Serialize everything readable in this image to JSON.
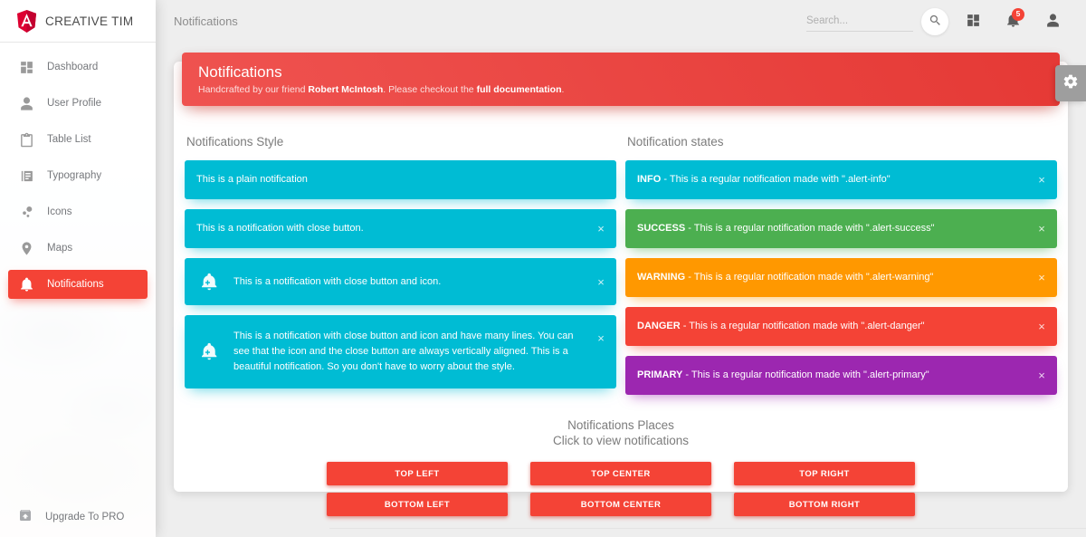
{
  "brand": {
    "name": "CREATIVE TIM",
    "logo_icon": "angular-shield-icon"
  },
  "sidebar": {
    "items": [
      {
        "label": "Dashboard",
        "icon": "dashboard-grid-icon",
        "active": false
      },
      {
        "label": "User Profile",
        "icon": "person-icon",
        "active": false
      },
      {
        "label": "Table List",
        "icon": "clipboard-icon",
        "active": false
      },
      {
        "label": "Typography",
        "icon": "library-books-icon",
        "active": false
      },
      {
        "label": "Icons",
        "icon": "bubble-chart-icon",
        "active": false
      },
      {
        "label": "Maps",
        "icon": "location-pin-icon",
        "active": false
      },
      {
        "label": "Notifications",
        "icon": "bell-icon",
        "active": true
      }
    ],
    "footer": {
      "label": "Upgrade To PRO",
      "icon": "unarchive-icon"
    }
  },
  "topbar": {
    "page_title": "Notifications",
    "search": {
      "value": "",
      "placeholder": "Search..."
    },
    "search_button_icon": "search-icon",
    "dashboard_icon": "dashboard-grid-icon",
    "notifications_icon": "bell-icon",
    "notifications_badge": "5",
    "profile_icon": "person-icon"
  },
  "gear_tab": {
    "icon": "gear-icon"
  },
  "card": {
    "header": {
      "title": "Notifications",
      "subtitle_prefix": "Handcrafted by our friend ",
      "author": "Robert McIntosh",
      "subtitle_middle": ". Please checkout the ",
      "doc_link": "full documentation",
      "subtitle_suffix": "."
    },
    "left_column": {
      "title": "Notifications Style",
      "alerts": [
        {
          "text": "This is a plain notification",
          "state": "info",
          "has_close": false,
          "has_icon": false,
          "close_label": "×"
        },
        {
          "text": "This is a notification with close button.",
          "state": "info",
          "has_close": true,
          "has_icon": false,
          "close_label": "×"
        },
        {
          "text": "This is a notification with close button and icon.",
          "state": "info",
          "has_close": true,
          "has_icon": true,
          "icon": "add-alert-icon",
          "close_label": "×"
        },
        {
          "text": "This is a notification with close button and icon and have many lines. You can see that the icon and the close button are always vertically aligned. This is a beautiful notification. So you don't have to worry about the style.",
          "state": "info",
          "has_close": true,
          "has_icon": true,
          "icon": "add-alert-icon",
          "tall": true,
          "close_label": "×"
        }
      ]
    },
    "right_column": {
      "title": "Notification states",
      "alerts": [
        {
          "label": "INFO",
          "text": " - This is a regular notification made with \".alert-info\"",
          "state": "info",
          "has_close": true,
          "close_label": "×"
        },
        {
          "label": "SUCCESS",
          "text": " - This is a regular notification made with \".alert-success\"",
          "state": "success",
          "has_close": true,
          "close_label": "×"
        },
        {
          "label": "WARNING",
          "text": " - This is a regular notification made with \".alert-warning\"",
          "state": "warning",
          "has_close": true,
          "close_label": "×"
        },
        {
          "label": "DANGER",
          "text": " - This is a regular notification made with \".alert-danger\"",
          "state": "danger",
          "has_close": true,
          "close_label": "×"
        },
        {
          "label": "PRIMARY",
          "text": " - This is a regular notification made with \".alert-primary\"",
          "state": "primary",
          "has_close": true,
          "close_label": "×"
        }
      ]
    },
    "places": {
      "title": "Notifications Places",
      "subtitle": "Click to view notifications",
      "buttons": [
        "TOP LEFT",
        "TOP CENTER",
        "TOP RIGHT",
        "BOTTOM LEFT",
        "BOTTOM CENTER",
        "BOTTOM RIGHT"
      ]
    }
  },
  "colors": {
    "info": "#00bcd4",
    "success": "#4caf50",
    "warning": "#ff9800",
    "danger": "#f44336",
    "primary": "#9c27b0",
    "brand_red": "#e53935",
    "page_bg": "#eeeeee"
  }
}
